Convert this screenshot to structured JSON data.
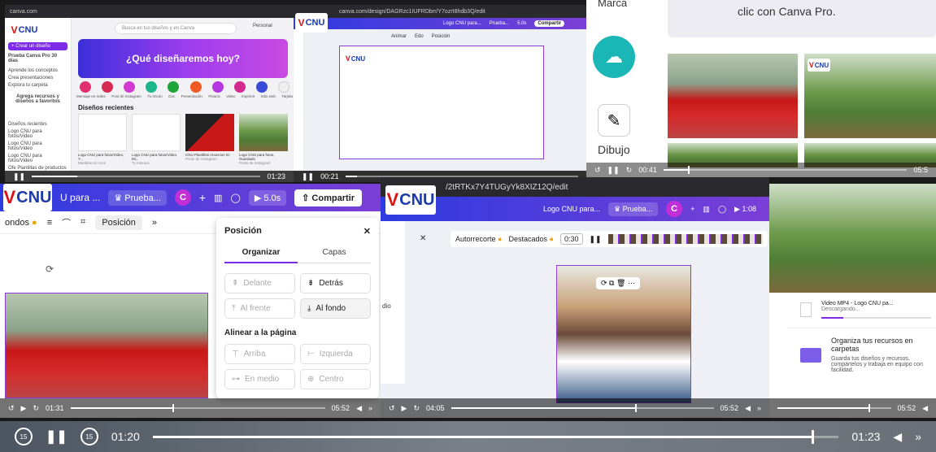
{
  "tl": {
    "url": "canva.com",
    "search_placeholder": "Busca en tus diseños y en Canva",
    "menu_create": "+ Crear un diseño",
    "trial": "Prueba Canva Pro 30 días",
    "sidebar_items": [
      "Aprende los conceptos",
      "Crea presentaciones",
      "Explora tu carpeta"
    ],
    "info_title": "Agrega recursos y diseños a favoritos",
    "recent_label": "Diseños recientes",
    "recent_items": [
      "Logo CNU para fotos/Video",
      "Logo CNU para fotos/Video",
      "Logo CNU para fotos/Video",
      "Ofe Plantillas de productos"
    ],
    "hero": "¿Qué diseñaremos hoy?",
    "shortcuts": [
      "Mensaje en redes",
      "Post de Instagram",
      "Tu rincón",
      "Doc",
      "Presentación",
      "Pizarra",
      "Video",
      "Imprimir",
      "Sitio web",
      "Tarjeta"
    ],
    "section_title": "Diseños recientes",
    "card_captions": [
      "Logo CNU para fotos/Video, Y...",
      "Logo CNU para fotos/Video, Mi...",
      "CNU Plantillas Anuncios IG",
      "Logo CNU para fotos, Guardado"
    ],
    "card_subs": [
      "Medidas en cmm",
      "7x minutos",
      "Posts de Instagram",
      "Posts de Instagram"
    ],
    "time": "01:23",
    "account": "Personal"
  },
  "tm": {
    "url": "canva.com/design/DAGRzc1IUFRDbrr/Y7ozrI8hdb3Q/edit",
    "title_tab": "Logo CNU para...",
    "trial": "Prueba...",
    "share": "Compartir",
    "duration": "5.0s",
    "toolbar": [
      "Animar",
      "Edo",
      "Posición"
    ],
    "time": "00:21"
  },
  "tr": {
    "top_text": "clic con Canva Pro.",
    "marca": "Marca",
    "dibujo": "Dibujo",
    "time": "00:41",
    "end_time": "05:5"
  },
  "bl": {
    "title": "U para ...",
    "trial": "Prueba...",
    "share": "Compartir",
    "duration": "5.0s",
    "fondos": "ondos",
    "posicion_btn": "Posición",
    "panel_title": "Posición",
    "tab_organizar": "Organizar",
    "tab_capas": "Capas",
    "items": [
      "Delante",
      "Detrás",
      "Al frente",
      "Al fondo"
    ],
    "align_title": "Alinear a la página",
    "align_items": [
      "Arriba",
      "Izquierda",
      "En medio",
      "Centro"
    ],
    "time_left": "01:31",
    "time_right": "05:52"
  },
  "bm": {
    "url": "/2tRTKx7Y4TUGyYk8XIZ12Q/edit",
    "title_tab": "Logo CNU para...",
    "trial": "Prueba...",
    "duration": "1:08",
    "autorecorte": "Autorrecorte",
    "destacados": "Destacados",
    "clip_time": "0:30",
    "dio": "dio",
    "time_left": "04:05",
    "time_right": "05:52"
  },
  "br": {
    "download_title": "Video MP4 - Logo CNU pa...",
    "download_status": "Descargando...",
    "org_title": "Organiza tus recursos en carpetas",
    "org_desc": "Guarda tus diseños y recursos, compártelos y trabaja en equipo con facilidad.",
    "time_right": "05:52"
  },
  "main": {
    "skip_back": "15",
    "skip_fwd": "15",
    "time_current": "01:20",
    "time_total": "01:23",
    "progress": 0.96
  },
  "brand": {
    "logo": "CNU",
    "v": "V"
  }
}
